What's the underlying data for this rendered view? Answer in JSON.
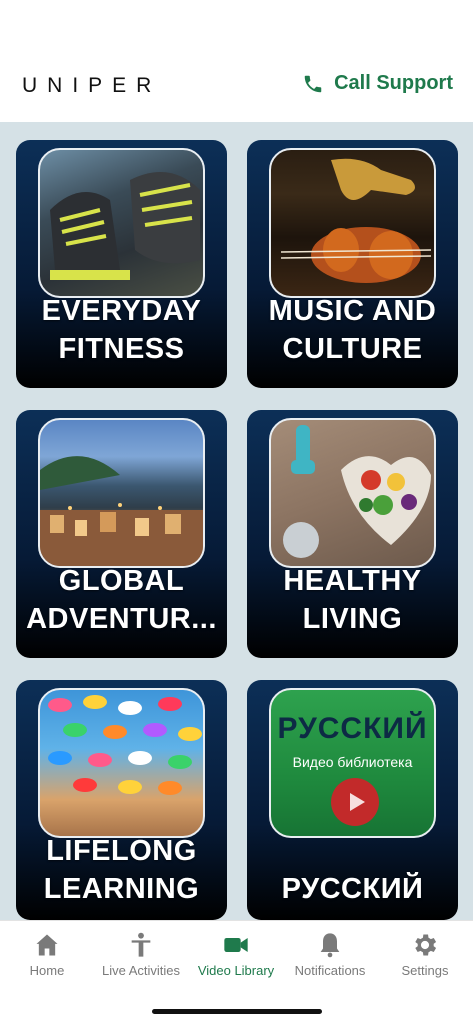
{
  "header": {
    "logo": "UNIPER",
    "call_support": "Call Support"
  },
  "tiles": [
    {
      "label_line1": "EVERYDAY",
      "label_line2": "FITNESS",
      "art": "sneakers-photo"
    },
    {
      "label_line1": "MUSIC AND",
      "label_line2": "CULTURE",
      "art": "violin-saxophone-photo"
    },
    {
      "label_line1": "GLOBAL",
      "label_line2": "ADVENTUR...",
      "art": "coastal-town-photo"
    },
    {
      "label_line1": "HEALTHY",
      "label_line2": "LIVING",
      "art": "dumbbells-vegetables-photo"
    },
    {
      "label_line1": "LIFELONG",
      "label_line2": "LEARNING",
      "art": "umbrellas-street-photo"
    },
    {
      "label_line1": "РУССКИЙ",
      "label_line2": "",
      "art": "russian-video-library-card",
      "art_title": "РУССКИЙ",
      "art_subtitle": "Видео библиотека"
    }
  ],
  "tabbar": {
    "items": [
      {
        "label": "Home",
        "icon": "home-icon"
      },
      {
        "label": "Live Activities",
        "icon": "person-icon"
      },
      {
        "label": "Video Library",
        "icon": "video-camera-icon",
        "active": true
      },
      {
        "label": "Notifications",
        "icon": "bell-icon"
      },
      {
        "label": "Settings",
        "icon": "gear-icon"
      }
    ]
  },
  "colors": {
    "accent": "#1f7a4c",
    "grid_background": "#d5e1e6",
    "tile_background": "#061a36"
  }
}
